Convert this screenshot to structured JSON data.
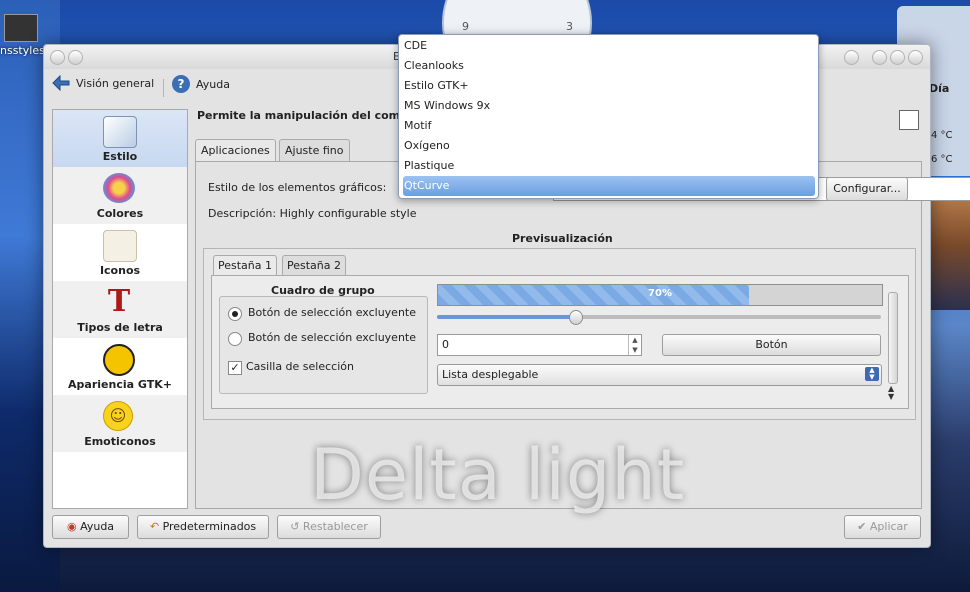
{
  "desktop": {
    "icon_label": "nsstyles",
    "clock_nine": "9",
    "clock_three": "3",
    "weather_day": "Día",
    "weather_temp1": "4 °C",
    "weather_temp2": "6 °C"
  },
  "window": {
    "title": "E"
  },
  "toolbar": {
    "overview_label": "Visión general",
    "help_label": "Ayuda"
  },
  "sidebar": {
    "items": [
      {
        "label": "Estilo"
      },
      {
        "label": "Colores"
      },
      {
        "label": "Iconos"
      },
      {
        "label": "Tipos de letra"
      },
      {
        "label": "Apariencia GTK+"
      },
      {
        "label": "Emoticonos"
      }
    ]
  },
  "content": {
    "header": "Permite la manipulación del compo",
    "tabs": [
      "Aplicaciones",
      "Ajuste fino"
    ],
    "style_label": "Estilo de los elementos gráficos:",
    "configure_button": "Configurar...",
    "description": "Descripción: Highly configurable style",
    "preview_title": "Previsualización"
  },
  "preview": {
    "tabs": [
      "Pestaña 1",
      "Pestaña 2"
    ],
    "groupbox_title": "Cuadro de grupo",
    "radio1": "Botón de selección excluyente",
    "radio2": "Botón de selección excluyente",
    "checkbox": "Casilla de selección",
    "progress_text": "70%",
    "progress_value": 70,
    "slider_value": 0.31,
    "spin_value": "0",
    "button": "Botón",
    "dropdown": "Lista desplegable"
  },
  "footer": {
    "help": "Ayuda",
    "defaults": "Predeterminados",
    "reset": "Restablecer",
    "apply": "Aplicar"
  },
  "popup": {
    "options": [
      "CDE",
      "Cleanlooks",
      "Estilo GTK+",
      "MS Windows 9x",
      "Motif",
      "Oxígeno",
      "Plastique",
      "QtCurve"
    ],
    "selected": "QtCurve"
  },
  "watermark": "Delta light",
  "colors": {
    "accent": "#6a9ee2",
    "progress": "#7aa9e3"
  }
}
